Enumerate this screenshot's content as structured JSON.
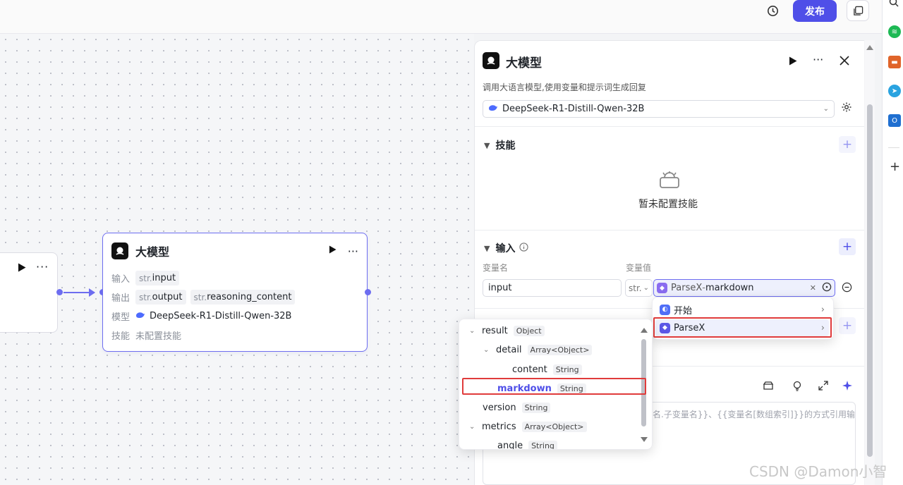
{
  "topbar": {
    "history_icon": "history-icon",
    "publish_label": "发布",
    "copy_icon": "copy-icon"
  },
  "canvas": {
    "prev_node": {
      "icons": [
        "play-icon",
        "more-icon"
      ]
    },
    "node": {
      "title": "大模型",
      "input_label": "输入",
      "input_type": "str.",
      "input_name": "input",
      "output_label": "输出",
      "output_type": "str.",
      "output_name": "output",
      "output2_type": "str.",
      "output2_name": "reasoning_content",
      "model_label": "模型",
      "model_value": "DeepSeek-R1-Distill-Qwen-32B",
      "skill_label": "技能",
      "skill_value": "未配置技能"
    }
  },
  "panel": {
    "title": "大模型",
    "description": "调用大语言模型,使用变量和提示词生成回复",
    "model_select": "DeepSeek-R1-Distill-Qwen-32B",
    "skills_section": "技能",
    "skills_empty": "暂未配置技能",
    "input_section": "输入",
    "var_name_header": "变量名",
    "var_value_header": "变量值",
    "var_name_value": "input",
    "var_type": "str.",
    "var_ref_node": "ParseX",
    "var_ref_sep": " - ",
    "var_ref_field": "markdown",
    "prompt_placeholder": "名.子变量名}}、{{变量名[数组索引]}}的方式引用输"
  },
  "node_menu": {
    "items": [
      {
        "label": "开始",
        "color": "#4f6ef7"
      },
      {
        "label": "ParseX",
        "color": "#5b57e6"
      }
    ]
  },
  "field_tree": {
    "rows": [
      {
        "name": "result",
        "type": "Object"
      },
      {
        "name": "detail",
        "type": "Array<Object>"
      },
      {
        "name": "content",
        "type": "String"
      },
      {
        "name": "markdown",
        "type": "String"
      },
      {
        "name": "version",
        "type": "String"
      },
      {
        "name": "metrics",
        "type": "Array<Object>"
      },
      {
        "name": "angle",
        "type": "String"
      }
    ]
  },
  "watermark": "CSDN @Damon小智",
  "colors": {
    "accent": "#4f4fe8",
    "highlight": "#e03b3b"
  }
}
